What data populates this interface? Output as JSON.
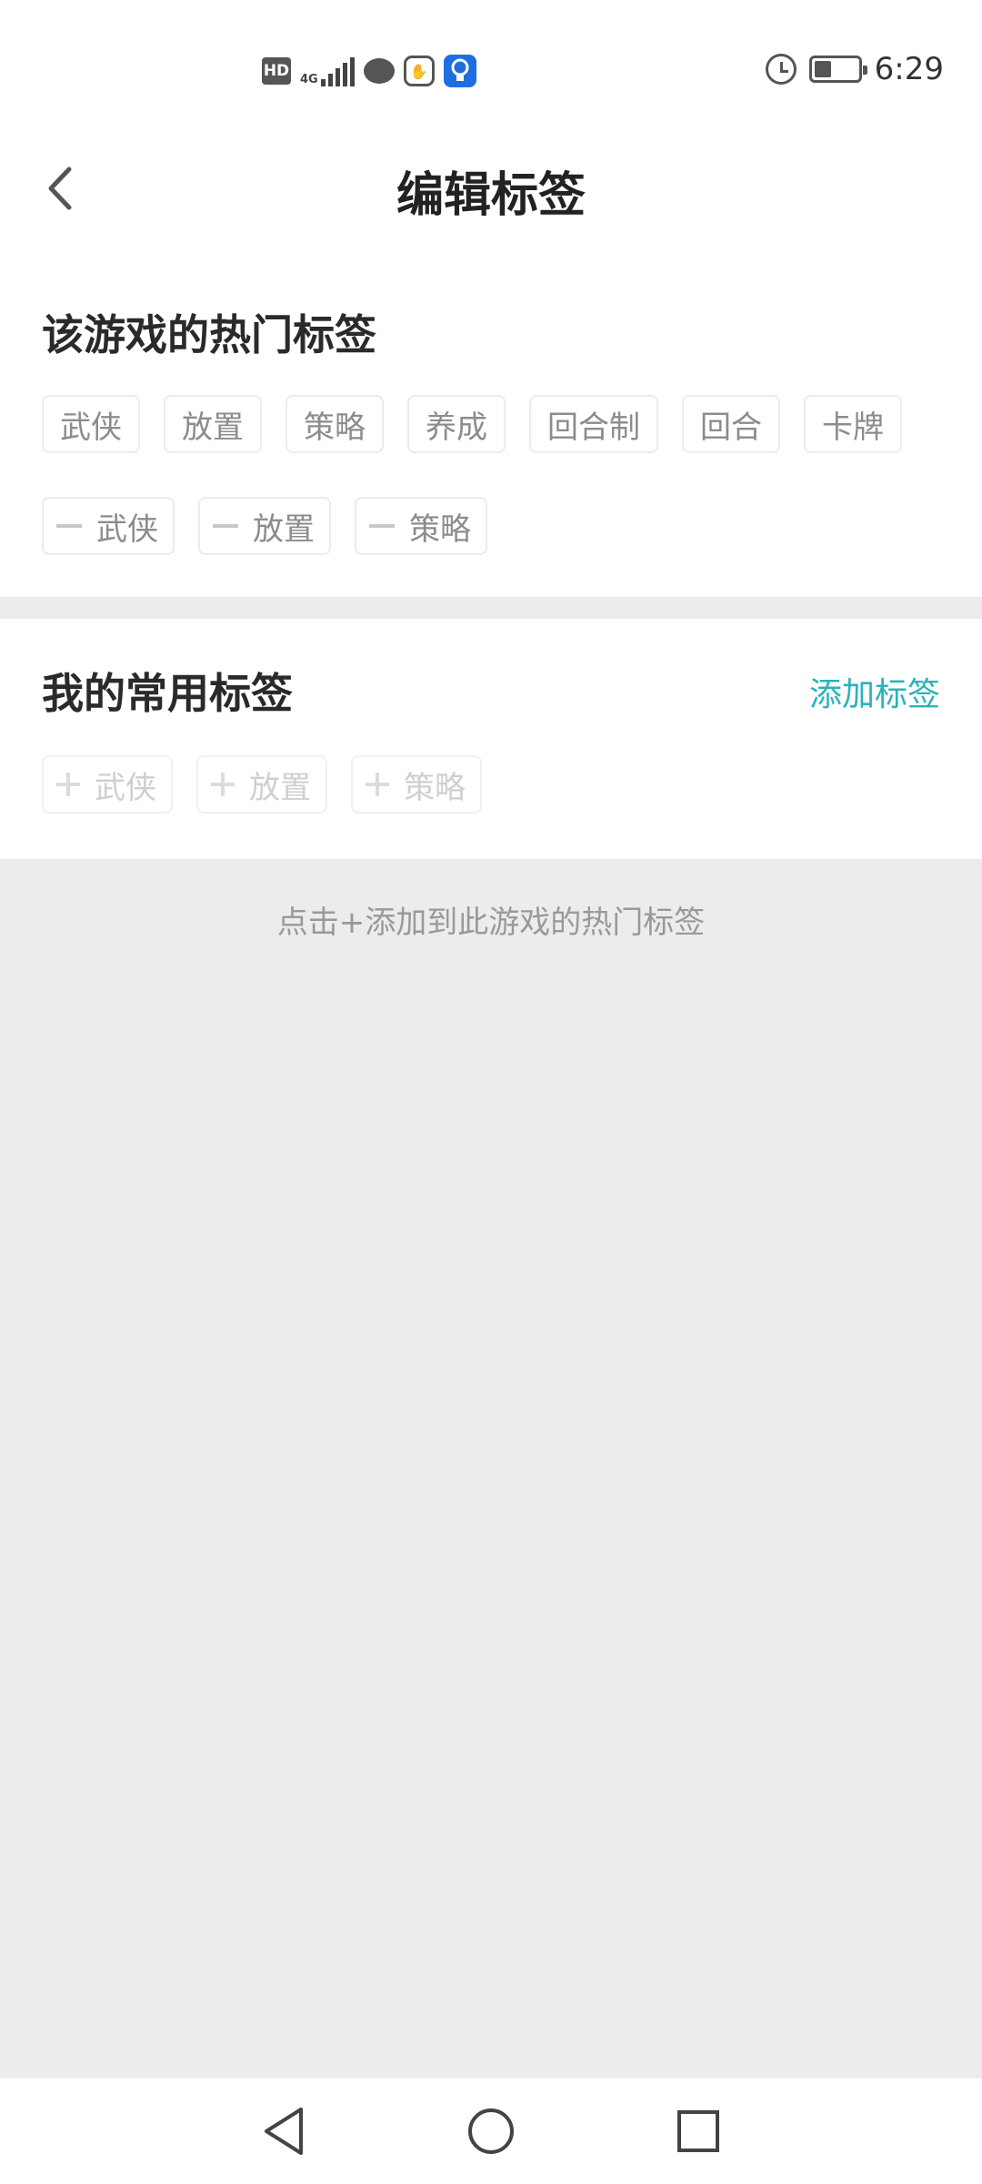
{
  "status_bar": {
    "hd": "HD",
    "network": "4G",
    "time": "6:29",
    "battery_level": 0.4
  },
  "header": {
    "title": "编辑标签"
  },
  "hot_tags": {
    "title": "该游戏的热门标签",
    "suggested": [
      "武侠",
      "放置",
      "策略",
      "养成",
      "回合制",
      "回合",
      "卡牌"
    ],
    "selected": [
      "武侠",
      "放置",
      "策略"
    ]
  },
  "common_tags": {
    "title": "我的常用标签",
    "add_label": "添加标签",
    "items": [
      "武侠",
      "放置",
      "策略"
    ]
  },
  "hint": "点击+添加到此游戏的热门标签",
  "colors": {
    "accent": "#2bb3b8",
    "background": "#ececec",
    "bulb_icon": "#1d6fe0"
  }
}
